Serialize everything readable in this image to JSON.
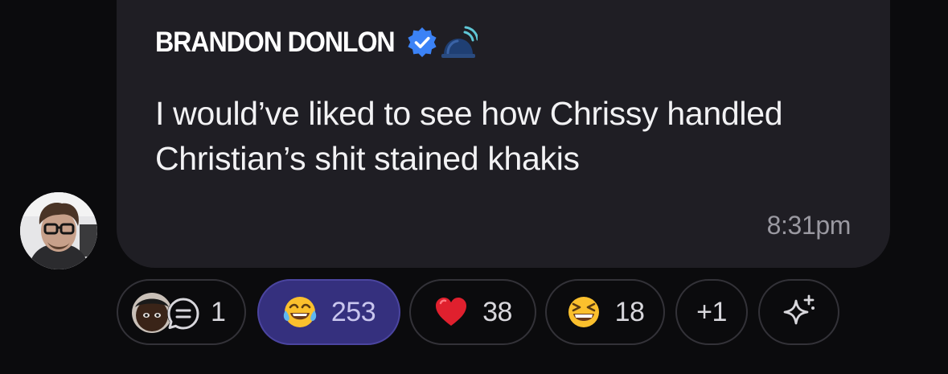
{
  "message": {
    "sender_name": "BRANDON DONLON",
    "badges": [
      "verified-icon",
      "siren-icon"
    ],
    "text": "I would’ve liked to see how Chrissy handled Christian’s shit stained khakis",
    "timestamp": "8:31pm"
  },
  "reactions": {
    "replies_count": "1",
    "items": [
      {
        "emoji": "face-with-tears-of-joy",
        "count": "253",
        "selected": true
      },
      {
        "emoji": "red-heart",
        "count": "38",
        "selected": false
      },
      {
        "emoji": "grinning-squinting-face",
        "count": "18",
        "selected": false
      }
    ],
    "more_label": "+1",
    "add_reaction_icon": "sparkle-icon"
  },
  "colors": {
    "background": "#0b0b0d",
    "bubble": "#1f1e24",
    "selected_reaction": "#35307e",
    "verified": "#3b82f6",
    "siren": "#2f4f7f"
  }
}
